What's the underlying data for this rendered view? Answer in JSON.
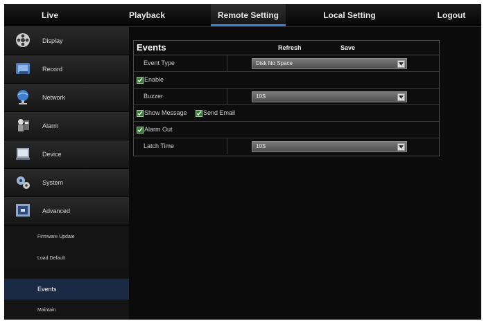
{
  "nav": {
    "items": [
      {
        "label": "Live",
        "icon": "none"
      },
      {
        "label": "Playback",
        "icon": "none"
      },
      {
        "label": "Remote Setting",
        "icon": "none"
      },
      {
        "label": "Local Setting",
        "icon": "none"
      },
      {
        "label": "Logout",
        "icon": "none"
      }
    ],
    "active": "Remote Setting",
    "accent": "#3a7fd8"
  },
  "sidebar": {
    "items": [
      {
        "label": "Display",
        "icon": "film-reel-icon"
      },
      {
        "label": "Record",
        "icon": "record-icon"
      },
      {
        "label": "Network",
        "icon": "network-globe-icon"
      },
      {
        "label": "Alarm",
        "icon": "alarm-icon"
      },
      {
        "label": "Device",
        "icon": "device-icon"
      },
      {
        "label": "System",
        "icon": "system-gears-icon"
      },
      {
        "label": "Advanced",
        "icon": "advanced-icon"
      }
    ],
    "subitems": [
      {
        "label": "Firmware Update"
      },
      {
        "label": "Load Default"
      },
      {
        "label": "Events"
      },
      {
        "label": "Maintain"
      }
    ],
    "active_subitem": "Events",
    "active_color": "#1a2a44"
  },
  "panel": {
    "title": "Events",
    "refresh_label": "Refresh",
    "save_label": "Save",
    "event_type": {
      "label": "Event Type",
      "value": "Disk No Space"
    },
    "enable": {
      "label": "Enable",
      "checked": true
    },
    "buzzer": {
      "label": "Buzzer",
      "value": "10S"
    },
    "show_message": {
      "label": "Show Message",
      "checked": true
    },
    "send_email": {
      "label": "Send Email",
      "checked": true
    },
    "alarm_out": {
      "label": "Alarm Out",
      "checked": true
    },
    "latch_time": {
      "label": "Latch Time",
      "value": "10S"
    }
  }
}
